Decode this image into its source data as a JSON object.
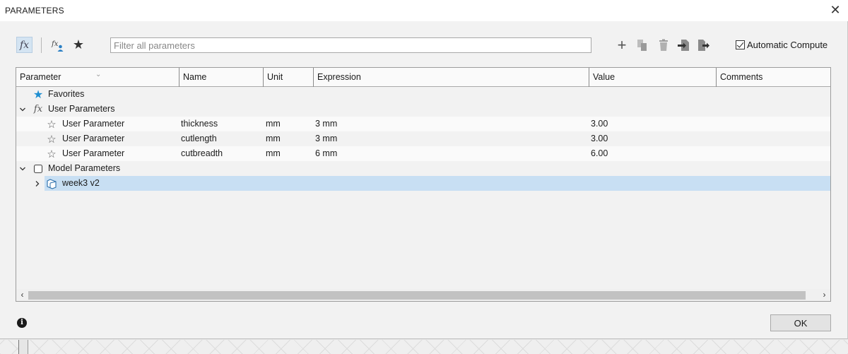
{
  "window": {
    "title": "PARAMETERS",
    "close_glyph": "✕"
  },
  "toolbar": {
    "filter_placeholder": "Filter all parameters",
    "filter_value": "",
    "auto_compute_label": "Automatic Compute",
    "auto_compute_checked": true,
    "icons": [
      "fx-icon",
      "fx-user-icon",
      "favorites-star-icon",
      "add-icon",
      "copy-icon",
      "delete-icon",
      "import-icon",
      "export-icon"
    ]
  },
  "table": {
    "columns": [
      "Parameter",
      "Name",
      "Unit",
      "Expression",
      "Value",
      "Comments"
    ],
    "rows": [
      {
        "type": "group",
        "label": "Favorites",
        "icon": "star-filled-icon",
        "expanded": null
      },
      {
        "type": "group",
        "label": "User Parameters",
        "icon": "fx-icon",
        "expanded": true
      },
      {
        "type": "param",
        "parameter": "User Parameter",
        "name": "thickness",
        "unit": "mm",
        "expression": "3 mm",
        "value": "3.00",
        "comments": ""
      },
      {
        "type": "param",
        "parameter": "User Parameter",
        "name": "cutlength",
        "unit": "mm",
        "expression": "3 mm",
        "value": "3.00",
        "comments": ""
      },
      {
        "type": "param",
        "parameter": "User Parameter",
        "name": "cutbreadth",
        "unit": "mm",
        "expression": "6 mm",
        "value": "6.00",
        "comments": ""
      },
      {
        "type": "group",
        "label": "Model Parameters",
        "icon": "model-icon",
        "expanded": true
      },
      {
        "type": "component",
        "label": "week3 v2",
        "icon": "component-icon",
        "expanded": false,
        "selected": true
      }
    ]
  },
  "footer": {
    "ok_label": "OK",
    "info_glyph": "i"
  },
  "colors": {
    "accent": "#1f8fd1",
    "selection": "#c8dff3",
    "fx_button": "#d4e4f2"
  }
}
